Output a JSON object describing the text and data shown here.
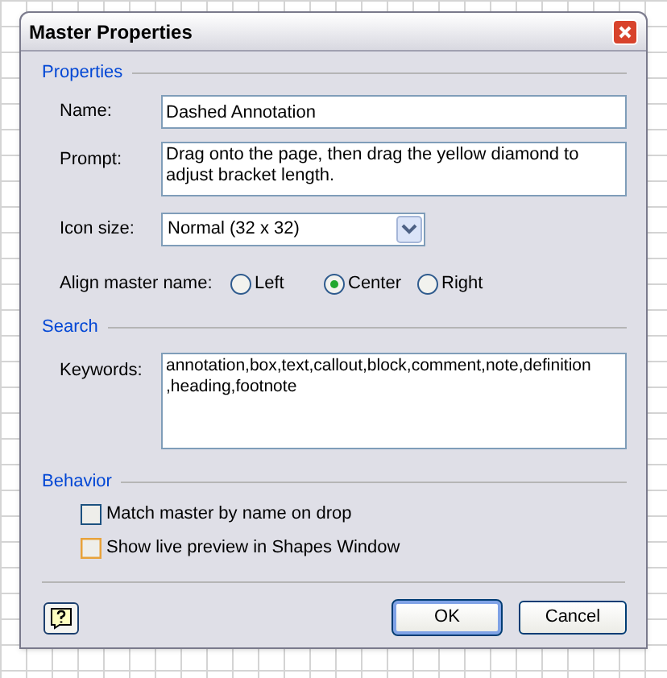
{
  "window": {
    "title": "Master Properties"
  },
  "properties": {
    "heading": "Properties",
    "name": {
      "label": "Name:",
      "value": "Dashed Annotation"
    },
    "prompt": {
      "label": "Prompt:",
      "value": "Drag onto the page, then drag the yellow diamond to adjust bracket length."
    },
    "icon_size": {
      "label": "Icon size:",
      "value": "Normal (32 x 32)"
    },
    "align": {
      "label": "Align master name:",
      "options": [
        {
          "label": "Left",
          "selected": false
        },
        {
          "label": "Center",
          "selected": true
        },
        {
          "label": "Right",
          "selected": false
        }
      ]
    }
  },
  "search": {
    "heading": "Search",
    "keywords": {
      "label": "Keywords:",
      "value": "annotation,box,text,callout,block,comment,note,definition\n,heading,footnote"
    }
  },
  "behavior": {
    "heading": "Behavior",
    "options": [
      {
        "label": "Match master by name on drop",
        "checked": false,
        "highlighted": false
      },
      {
        "label": "Show live preview in Shapes Window",
        "checked": false,
        "highlighted": true
      }
    ]
  },
  "buttons": [
    {
      "label": "OK",
      "default": true
    },
    {
      "label": "Cancel",
      "default": false
    }
  ]
}
